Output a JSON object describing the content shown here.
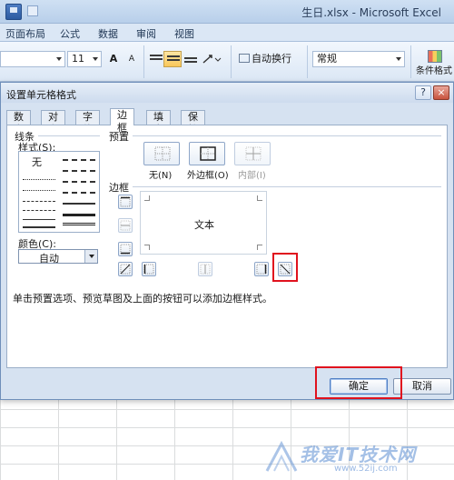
{
  "app": {
    "title": "生日.xlsx - Microsoft Excel"
  },
  "ribbon": {
    "tabs": [
      "页面布局",
      "公式",
      "数据",
      "审阅",
      "视图"
    ],
    "font_size": "11",
    "grow_font": "A",
    "shrink_font": "A",
    "wrap_text": "自动换行",
    "number_format": "常规",
    "conditional_format": "条件格式"
  },
  "dialog": {
    "title": "设置单元格格式",
    "help": "?",
    "close": "×",
    "tabs": [
      "数字",
      "对齐",
      "字体",
      "边框",
      "填充",
      "保护"
    ],
    "active_tab": "边框",
    "line_section": "线条",
    "style_label": "样式(S):",
    "style_none": "无",
    "color_label": "颜色(C):",
    "color_value": "自动",
    "preset_section": "预置",
    "presets": [
      {
        "label": "无(N)",
        "enabled": true
      },
      {
        "label": "外边框(O)",
        "enabled": true
      },
      {
        "label": "内部(I)",
        "enabled": false
      }
    ],
    "border_section": "边框",
    "preview_text": "文本",
    "hint": "单击预置选项、预览草图及上面的按钮可以添加边框样式。",
    "ok": "确定",
    "cancel": "取消"
  },
  "watermark": {
    "text": "我爱IT技术网",
    "url": "www.52ij.com"
  },
  "colors": {
    "highlight": "#e0121e",
    "dialog_bg": "#d6e2f1",
    "title_bar": "#b8cfea"
  }
}
